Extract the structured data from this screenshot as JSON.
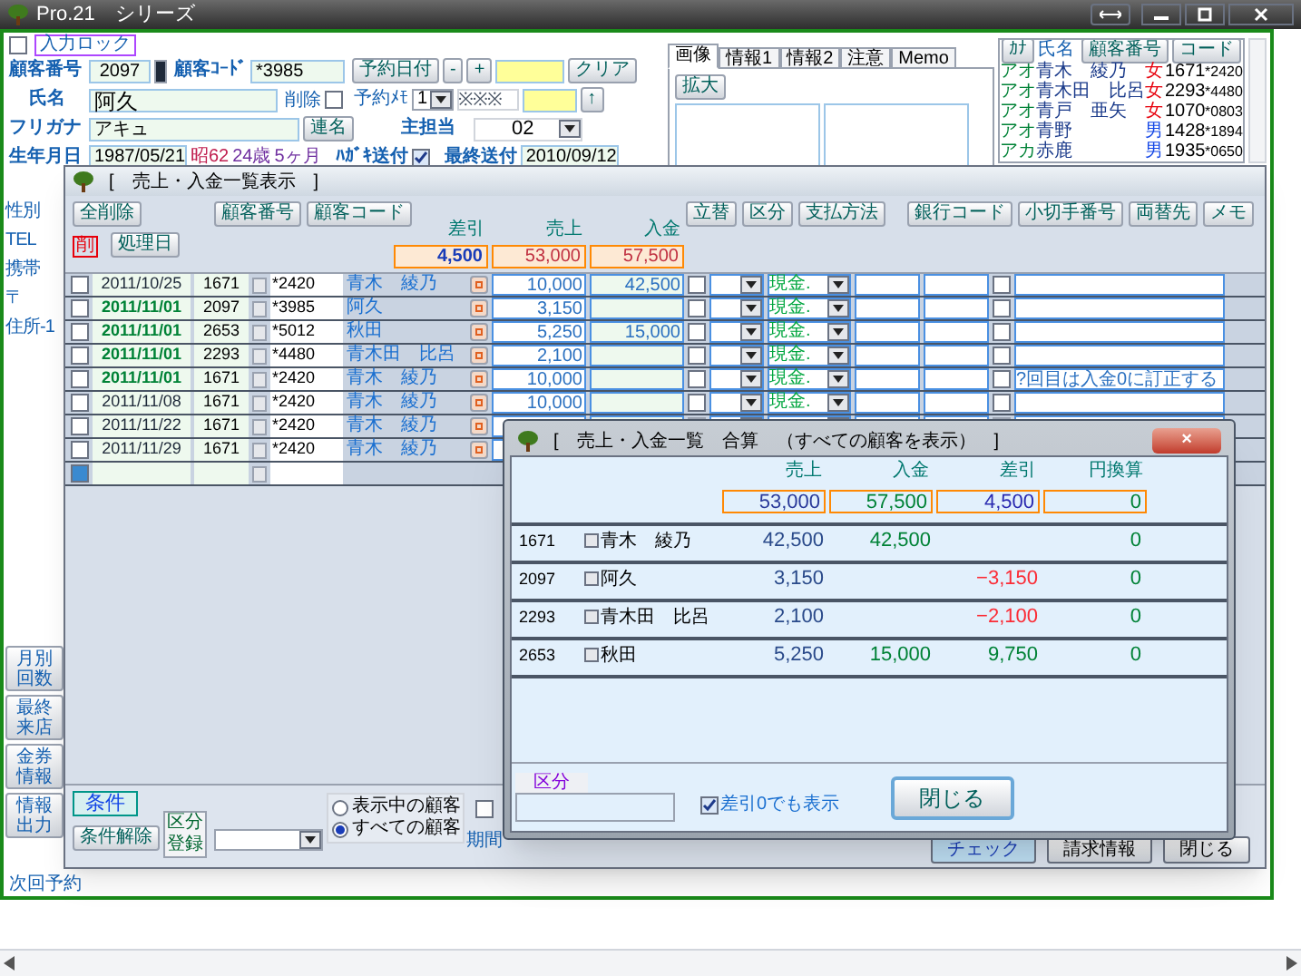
{
  "window": {
    "title": "Pro.21　シリーズ"
  },
  "form": {
    "input_lock": {
      "label": "入力ロック",
      "checked": false
    },
    "customer_number": {
      "label": "顧客番号",
      "value": "2097"
    },
    "customer_code": {
      "label": "顧客ｺｰﾄﾞ",
      "value": "*3985"
    },
    "reserve_date_button": "予約日付",
    "minus_button": "-",
    "plus_button": "+",
    "clear_button": "クリア",
    "name": {
      "label": "氏名",
      "value": "阿久"
    },
    "delete": {
      "label": "削除",
      "checked": false
    },
    "reserve_memo": {
      "label": "予約ﾒﾓ",
      "value": "1",
      "field_value": "※※※"
    },
    "up_button": "↑",
    "furigana": {
      "label": "フリガナ",
      "value": "アキュ"
    },
    "joint_button": "連名",
    "staff": {
      "label": "主担当",
      "value": "02"
    },
    "birthday": {
      "label": "生年月日",
      "value": "1987/05/21",
      "era": "昭62",
      "age": "24歳",
      "months": "5ヶ月"
    },
    "postcard": {
      "label": "ﾊｶﾞｷ送付",
      "checked": true
    },
    "last_sent": {
      "label": "最終送付",
      "value": "2010/09/12"
    },
    "side_labels": [
      "性別",
      "TEL",
      "携帯",
      "〒",
      "住所-1"
    ],
    "side_buttons": [
      "月別回数",
      "最終来店",
      "金券情報",
      "情報出力"
    ],
    "next_label": "次回予約"
  },
  "tabs": [
    {
      "label": "画像",
      "selected": true
    },
    {
      "label": "情報1",
      "selected": false
    },
    {
      "label": "情報2",
      "selected": false
    },
    {
      "label": "注意",
      "selected": false
    },
    {
      "label": "Memo",
      "selected": false
    }
  ],
  "enlarge_button": "拡大",
  "customer_list": {
    "kana_button": "ｶﾅ",
    "name_header": "氏名",
    "number_button": "顧客番号",
    "code_button": "コード",
    "rows": [
      {
        "kana": "アオ",
        "name": "青木　綾乃",
        "gender": "女",
        "kind": "female",
        "number": "1671",
        "code": "*2420"
      },
      {
        "kana": "アオ",
        "name": "青木田　比呂",
        "gender": "女",
        "kind": "female",
        "number": "2293",
        "code": "*4480"
      },
      {
        "kana": "アオ",
        "name": "青戸　亜矢",
        "gender": "女",
        "kind": "female",
        "number": "1070",
        "code": "*0803"
      },
      {
        "kana": "アオ",
        "name": "青野",
        "gender": "男",
        "kind": "male",
        "number": "1428",
        "code": "*1894"
      },
      {
        "kana": "アカ",
        "name": "赤鹿",
        "gender": "男",
        "kind": "male",
        "number": "1935",
        "code": "*0650"
      }
    ]
  },
  "list_window": {
    "title": "[　売上・入金一覧表示　]",
    "buttons": {
      "delete_all": "全削除",
      "customer_number": "顧客番号",
      "customer_code": "顧客コード",
      "process_date": "処理日",
      "delete_mark": "削"
    },
    "column_labels": {
      "discount": "差引",
      "sales": "売上",
      "payment": "入金"
    },
    "totals": {
      "discount": "4,500",
      "sales": "53,000",
      "payment": "57,500"
    },
    "right_buttons": [
      "立替",
      "区分",
      "支払方法",
      "銀行コード",
      "小切手番号",
      "両替先",
      "メモ"
    ],
    "rows": [
      {
        "checked": false,
        "date": "2011/10/25",
        "emphasized": false,
        "number": "1671",
        "code": "*2420",
        "name": "青木　綾乃",
        "sales": "10,000",
        "payment": "42,500",
        "advance": false,
        "method": "現金.",
        "exchange": false,
        "memo": ""
      },
      {
        "checked": false,
        "date": "2011/11/01",
        "emphasized": true,
        "number": "2097",
        "code": "*3985",
        "name": "阿久",
        "sales": "3,150",
        "payment": "",
        "advance": false,
        "method": "現金.",
        "exchange": false,
        "memo": ""
      },
      {
        "checked": false,
        "date": "2011/11/01",
        "emphasized": true,
        "number": "2653",
        "code": "*5012",
        "name": "秋田",
        "sales": "5,250",
        "payment": "15,000",
        "advance": false,
        "method": "現金.",
        "exchange": false,
        "memo": ""
      },
      {
        "checked": false,
        "date": "2011/11/01",
        "emphasized": true,
        "number": "2293",
        "code": "*4480",
        "name": "青木田　比呂",
        "sales": "2,100",
        "payment": "",
        "advance": false,
        "method": "現金.",
        "exchange": false,
        "memo": ""
      },
      {
        "checked": false,
        "date": "2011/11/01",
        "emphasized": true,
        "number": "1671",
        "code": "*2420",
        "name": "青木　綾乃",
        "sales": "10,000",
        "payment": "",
        "advance": false,
        "method": "現金.",
        "exchange": false,
        "memo": "?回目は入金0に訂正する"
      },
      {
        "checked": false,
        "date": "2011/11/08",
        "emphasized": false,
        "number": "1671",
        "code": "*2420",
        "name": "青木　綾乃",
        "sales": "10,000",
        "payment": "",
        "advance": false,
        "method": "現金.",
        "exchange": false,
        "memo": ""
      },
      {
        "checked": false,
        "date": "2011/11/22",
        "emphasized": false,
        "number": "1671",
        "code": "*2420",
        "name": "青木　綾乃",
        "sales": "",
        "payment": "",
        "method": "",
        "memo": ""
      },
      {
        "checked": false,
        "date": "2011/11/29",
        "emphasized": false,
        "number": "1671",
        "code": "*2420",
        "name": "青木　綾乃",
        "sales": "",
        "payment": "",
        "method": "",
        "memo": ""
      }
    ],
    "condition_button": "条件",
    "clear_condition_button": "条件解除",
    "category_button": "区分登録",
    "radios": [
      {
        "label": "表示中の顧客",
        "selected": false
      },
      {
        "label": "すべての顧客",
        "selected": true
      }
    ],
    "period_check": {
      "checked": false
    },
    "period_label": "期間",
    "bottom_buttons": [
      "チェック",
      "請求情報",
      "閉じる"
    ]
  },
  "summary_dialog": {
    "title": "[　売上・入金一覧　合算　（すべての顧客を表示）　]",
    "close": "×",
    "columns": [
      "売上",
      "入金",
      "差引",
      "円換算"
    ],
    "totals": [
      "53,000",
      "57,500",
      "4,500",
      "0"
    ],
    "rows": [
      {
        "number": "1671",
        "name": "青木　綾乃",
        "sales": "42,500",
        "payment": "42,500",
        "difference": "",
        "negative": false,
        "yen": "0"
      },
      {
        "number": "2097",
        "name": "阿久",
        "sales": "3,150",
        "payment": "",
        "difference": "−3,150",
        "negative": true,
        "yen": "0"
      },
      {
        "number": "2293",
        "name": "青木田　比呂",
        "sales": "2,100",
        "payment": "",
        "difference": "−2,100",
        "negative": true,
        "yen": "0"
      },
      {
        "number": "2653",
        "name": "秋田",
        "sales": "5,250",
        "payment": "15,000",
        "difference": "9,750",
        "negative": false,
        "yen": "0"
      }
    ],
    "category_label": "区分",
    "show_zero": {
      "label": "差引0でも表示",
      "checked": true
    },
    "close_button": "閉じる"
  }
}
